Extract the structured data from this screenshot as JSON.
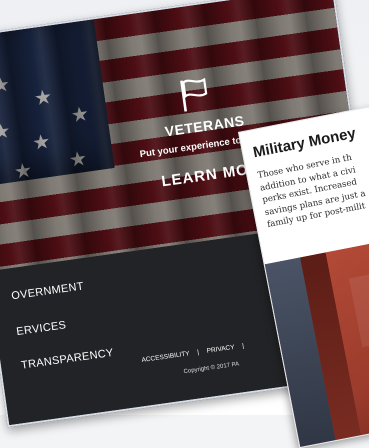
{
  "back_page": {
    "hero": {
      "icon": "flag-icon",
      "title": "VETERANS",
      "subtitle": "Put your experience to work for us",
      "cta": "LEARN MORE"
    },
    "nav": {
      "items": [
        "OVERNMENT",
        "ERVICES",
        "TRANSPARENCY"
      ]
    },
    "footer": {
      "links": [
        "ACCESSIBILITY",
        "|",
        "PRIVACY",
        "|"
      ],
      "copyright": "Copyright © 2017 PA"
    }
  },
  "front_page": {
    "title": "Military Money",
    "body_lines": [
      "Those who serve in th",
      "addition to what a civi",
      "perks exist. Increased",
      "savings plans are just a",
      "family up for post-milit"
    ]
  }
}
